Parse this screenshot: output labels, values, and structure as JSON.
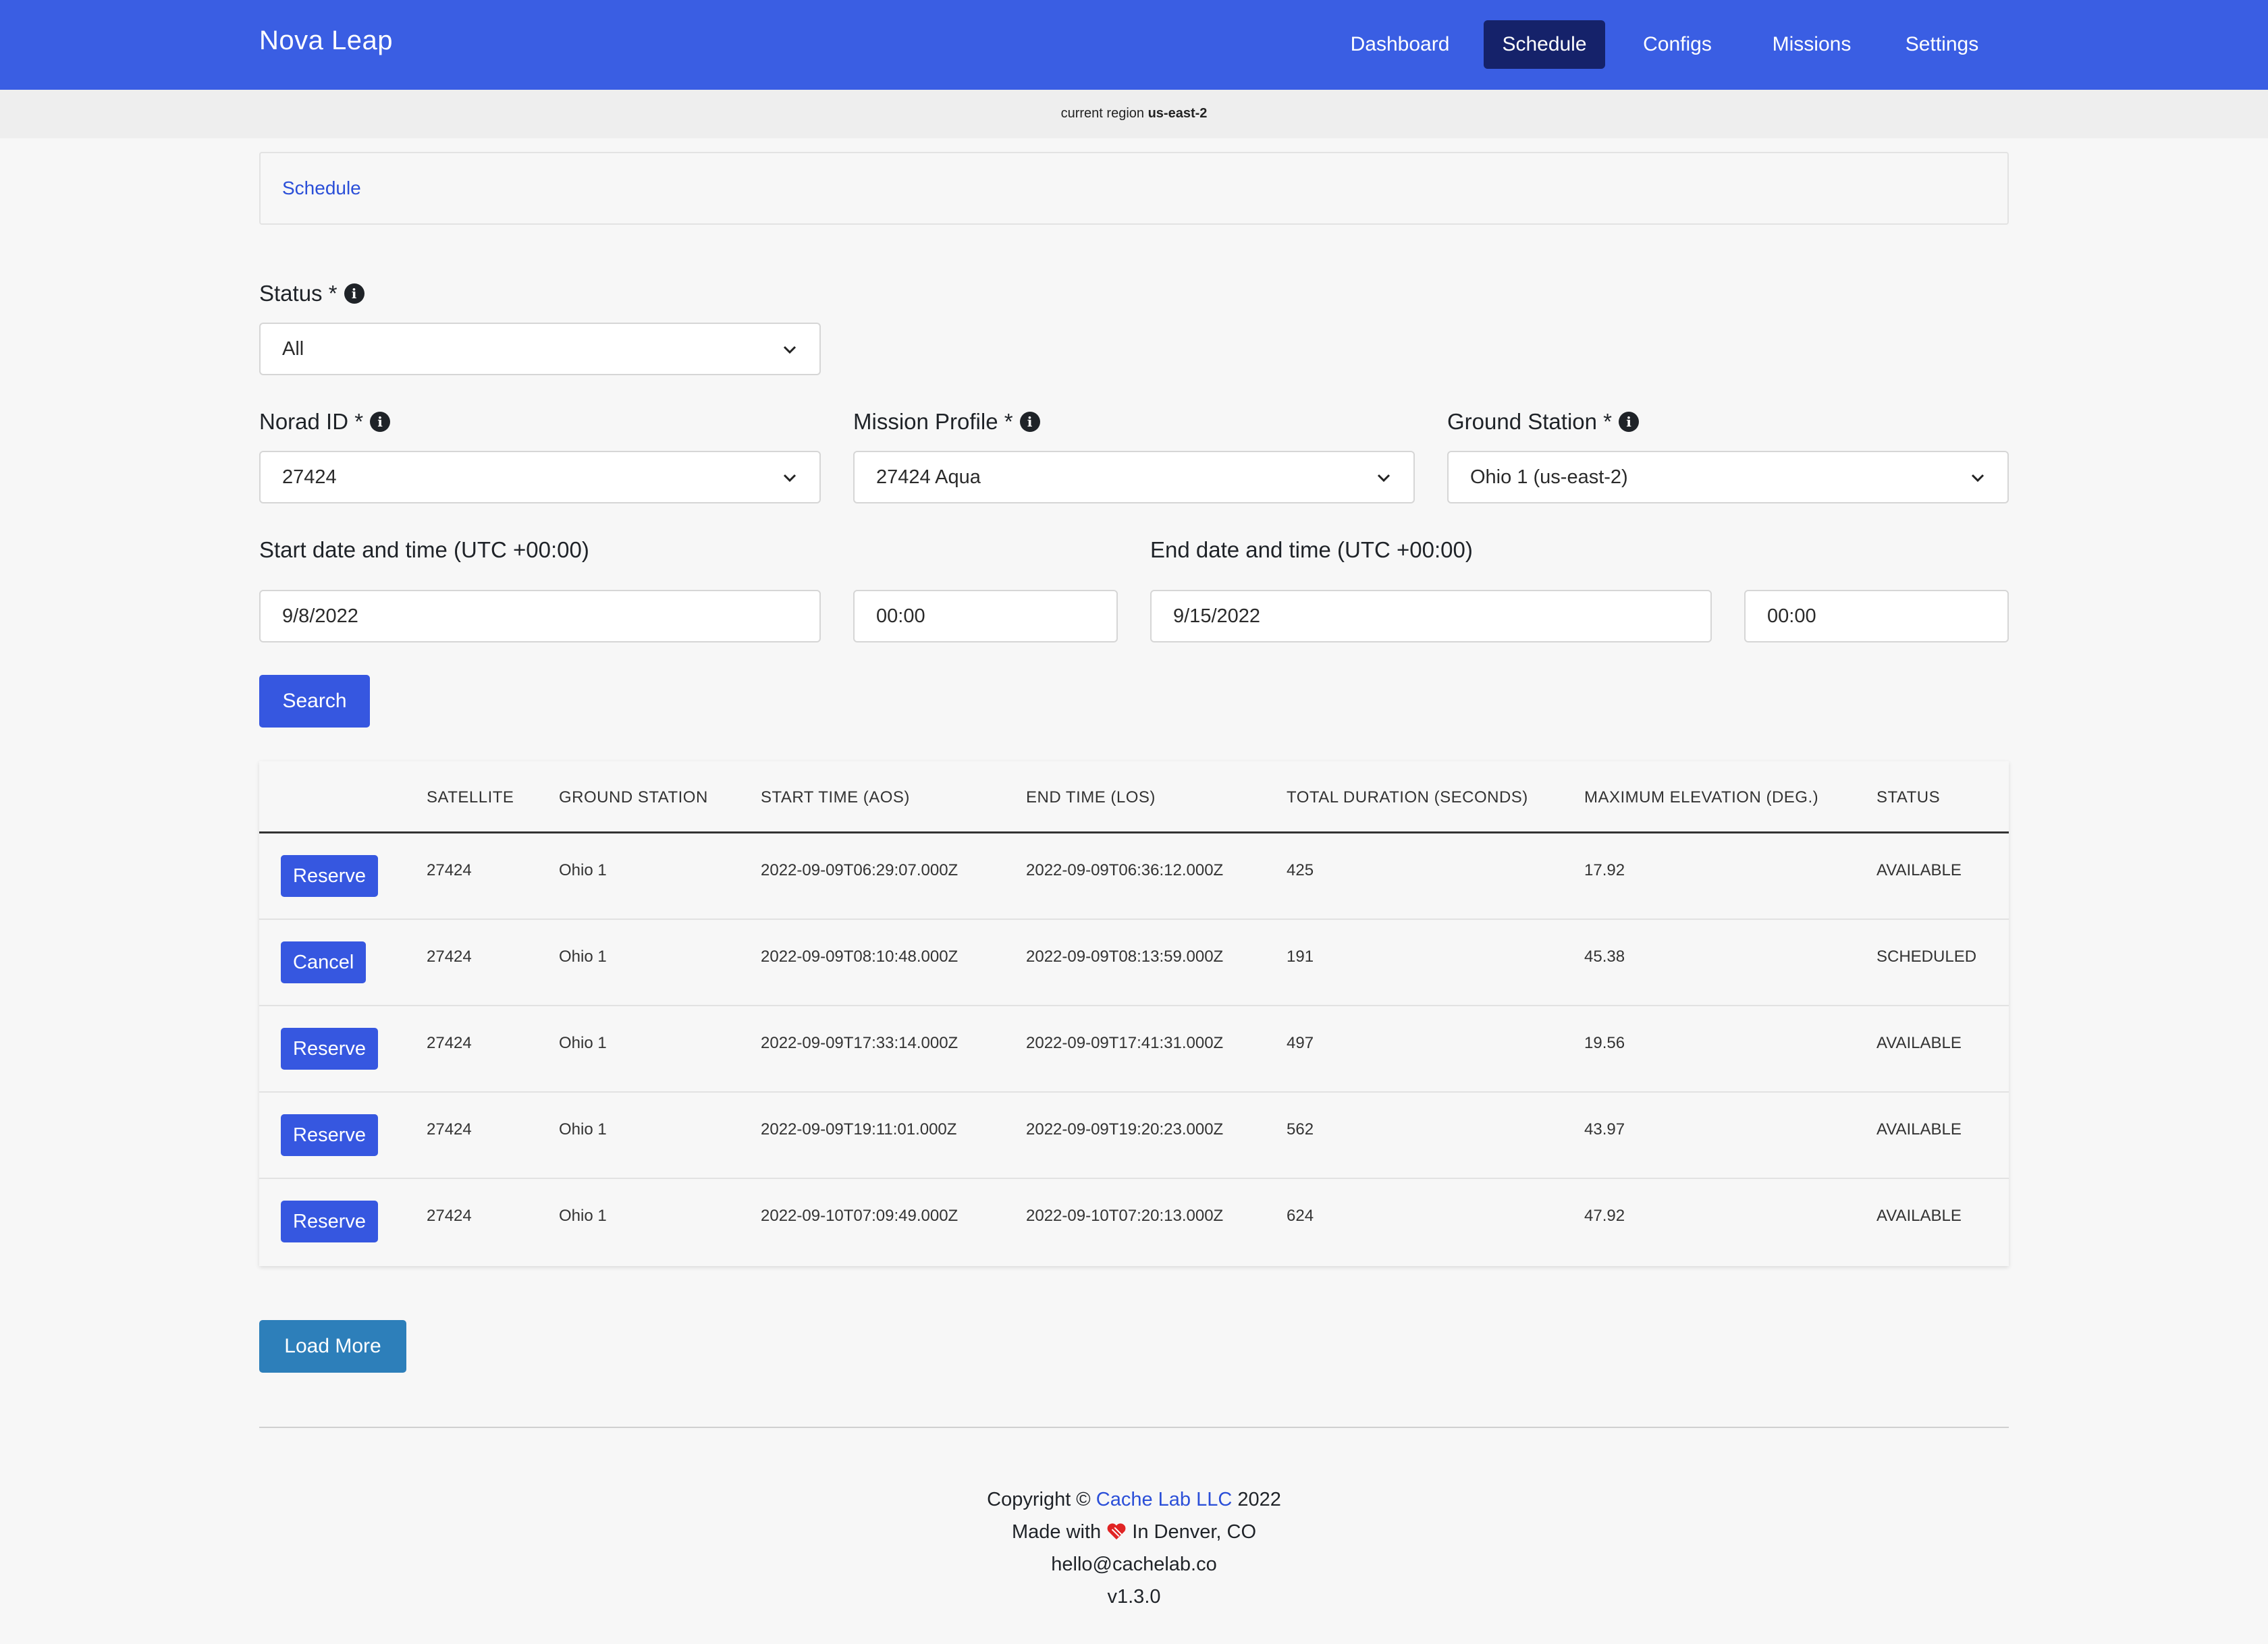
{
  "navbar": {
    "brand": "Nova Leap",
    "links": [
      {
        "label": "Dashboard",
        "active": false
      },
      {
        "label": "Schedule",
        "active": true
      },
      {
        "label": "Configs",
        "active": false
      },
      {
        "label": "Missions",
        "active": false
      },
      {
        "label": "Settings",
        "active": false
      }
    ]
  },
  "region": {
    "prefix": "current region",
    "value": "us-east-2"
  },
  "breadcrumb": {
    "label": "Schedule"
  },
  "form": {
    "status": {
      "label": "Status *",
      "value": "All"
    },
    "norad": {
      "label": "Norad ID *",
      "value": "27424"
    },
    "mission_profile": {
      "label": "Mission Profile *",
      "value": "27424 Aqua"
    },
    "ground_station": {
      "label": "Ground Station *",
      "value": "Ohio 1 (us-east-2)"
    },
    "start": {
      "label": "Start date and time (UTC +00:00)",
      "date": "9/8/2022",
      "time": "00:00"
    },
    "end": {
      "label": "End date and time (UTC +00:00)",
      "date": "9/15/2022",
      "time": "00:00"
    },
    "search_label": "Search"
  },
  "table": {
    "headers": [
      "SATELLITE",
      "GROUND STATION",
      "START TIME (AOS)",
      "END TIME (LOS)",
      "TOTAL DURATION (SECONDS)",
      "MAXIMUM ELEVATION (DEG.)",
      "STATUS"
    ],
    "rows": [
      {
        "action": "Reserve",
        "satellite": "27424",
        "station": "Ohio 1",
        "start": "2022-09-09T06:29:07.000Z",
        "end": "2022-09-09T06:36:12.000Z",
        "duration": "425",
        "elevation": "17.92",
        "status": "AVAILABLE"
      },
      {
        "action": "Cancel",
        "satellite": "27424",
        "station": "Ohio 1",
        "start": "2022-09-09T08:10:48.000Z",
        "end": "2022-09-09T08:13:59.000Z",
        "duration": "191",
        "elevation": "45.38",
        "status": "SCHEDULED"
      },
      {
        "action": "Reserve",
        "satellite": "27424",
        "station": "Ohio 1",
        "start": "2022-09-09T17:33:14.000Z",
        "end": "2022-09-09T17:41:31.000Z",
        "duration": "497",
        "elevation": "19.56",
        "status": "AVAILABLE"
      },
      {
        "action": "Reserve",
        "satellite": "27424",
        "station": "Ohio 1",
        "start": "2022-09-09T19:11:01.000Z",
        "end": "2022-09-09T19:20:23.000Z",
        "duration": "562",
        "elevation": "43.97",
        "status": "AVAILABLE"
      },
      {
        "action": "Reserve",
        "satellite": "27424",
        "station": "Ohio 1",
        "start": "2022-09-10T07:09:49.000Z",
        "end": "2022-09-10T07:20:13.000Z",
        "duration": "624",
        "elevation": "47.92",
        "status": "AVAILABLE"
      }
    ]
  },
  "load_more_label": "Load More",
  "footer": {
    "copyright_prefix": "Copyright ©",
    "company": "Cache Lab LLC",
    "year": "2022",
    "made_with": "Made with",
    "location": "In Denver, CO",
    "email": "hello@cachelab.co",
    "version": "v1.3.0"
  },
  "colors": {
    "navbar": "#3a5ee3",
    "nav_active": "#15226a",
    "primary_button": "#3657e0",
    "load_more_button": "#2d7fba",
    "link": "#2b4fd8",
    "background": "#f7f7f7"
  },
  "icons": {
    "info": "info-icon",
    "chevron": "chevron-down-icon",
    "heart": "heart-icon"
  }
}
